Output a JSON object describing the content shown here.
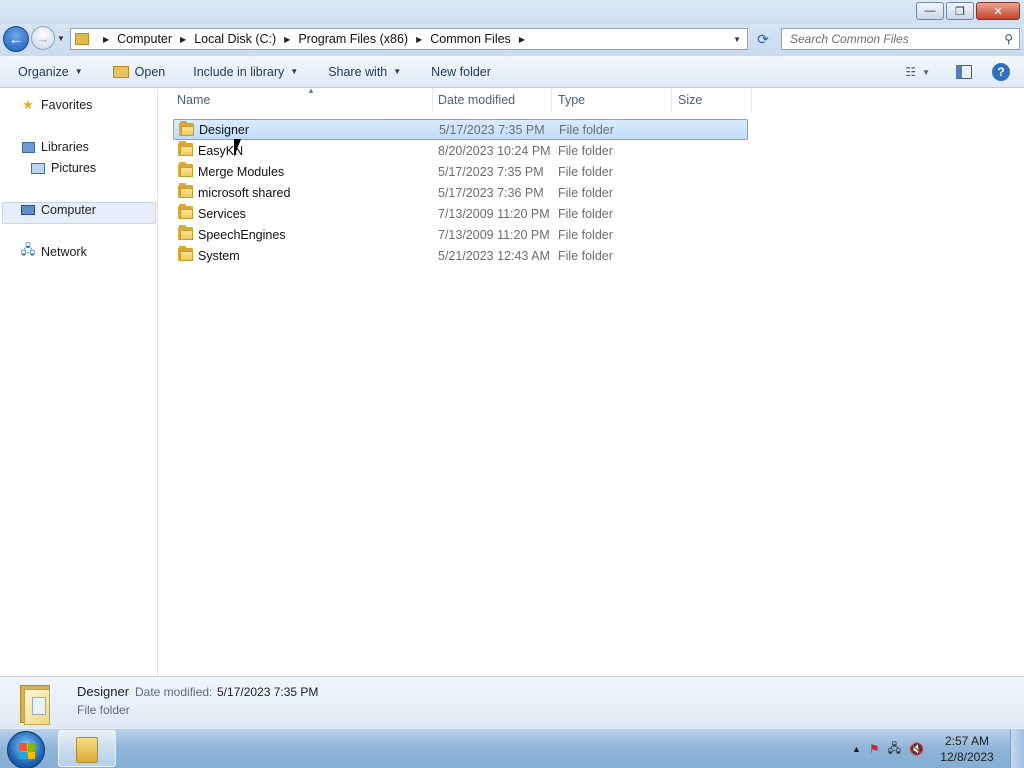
{
  "window": {
    "title": "",
    "controls": {
      "minimize": "—",
      "maximize": "❐",
      "close": "✕"
    }
  },
  "address": {
    "breadcrumbs": [
      "Computer",
      "Local Disk (C:)",
      "Program Files (x86)",
      "Common Files"
    ],
    "search_placeholder": "Search Common Files"
  },
  "toolbar": {
    "organize": "Organize",
    "open": "Open",
    "include": "Include in library",
    "share": "Share with",
    "new_folder": "New folder"
  },
  "nav": {
    "favorites": "Favorites",
    "libraries": "Libraries",
    "pictures": "Pictures",
    "computer": "Computer",
    "network": "Network"
  },
  "columns": {
    "name": "Name",
    "date": "Date modified",
    "type": "Type",
    "size": "Size"
  },
  "files": [
    {
      "name": "Designer",
      "date": "5/17/2023 7:35 PM",
      "type": "File folder",
      "selected": true
    },
    {
      "name": "EasyKN",
      "date": "8/20/2023 10:24 PM",
      "type": "File folder"
    },
    {
      "name": "Merge Modules",
      "date": "5/17/2023 7:35 PM",
      "type": "File folder"
    },
    {
      "name": "microsoft shared",
      "date": "5/17/2023 7:36 PM",
      "type": "File folder"
    },
    {
      "name": "Services",
      "date": "7/13/2009 11:20 PM",
      "type": "File folder"
    },
    {
      "name": "SpeechEngines",
      "date": "7/13/2009 11:20 PM",
      "type": "File folder"
    },
    {
      "name": "System",
      "date": "5/21/2023 12:43 AM",
      "type": "File folder"
    }
  ],
  "details": {
    "name": "Designer",
    "date_label": "Date modified:",
    "date_value": "5/17/2023 7:35 PM",
    "type": "File folder"
  },
  "taskbar": {
    "time": "2:57 AM",
    "date": "12/8/2023"
  },
  "colors": {
    "selection": "#c1dcfc",
    "accent": "#1d5fa8"
  }
}
